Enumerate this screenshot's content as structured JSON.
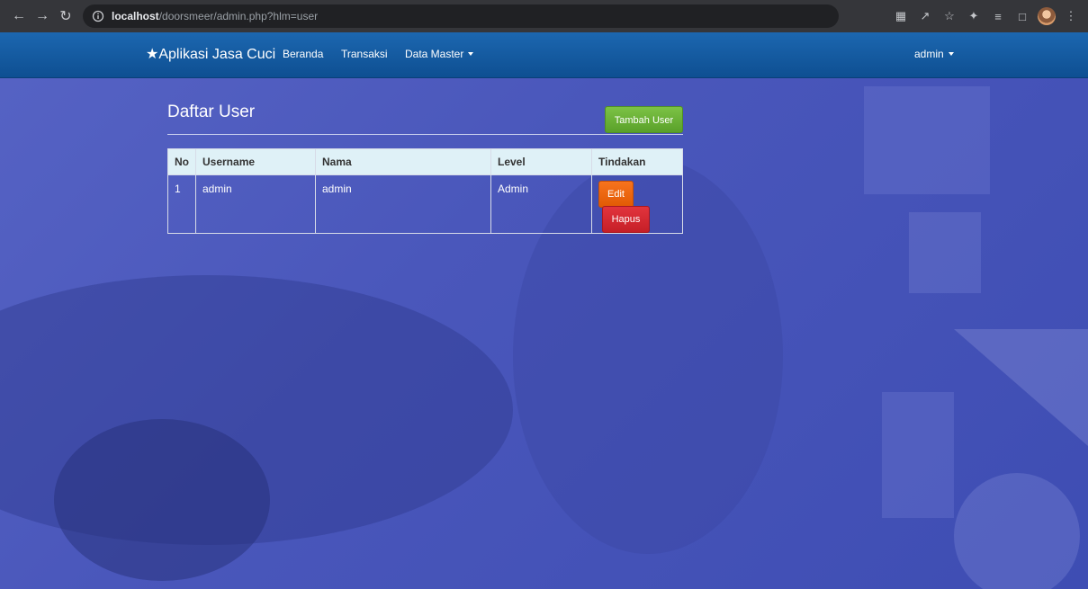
{
  "browser": {
    "url_host": "localhost",
    "url_path": "/doorsmeer/admin.php?hlm=user",
    "back_icon": "arrow-left-icon",
    "forward_icon": "arrow-right-icon",
    "reload_icon": "reload-icon"
  },
  "navbar": {
    "brand": "★Aplikasi Jasa Cuci",
    "links": [
      "Beranda",
      "Transaksi",
      "Data Master"
    ],
    "user": "admin",
    "color": "#1565ad"
  },
  "main": {
    "title": "Daftar User",
    "add_button": "Tambah User",
    "table": {
      "headers": [
        "No",
        "Username",
        "Nama",
        "Level",
        "Tindakan"
      ],
      "rows": [
        {
          "no": "1",
          "username": "admin",
          "nama": "admin",
          "level": "Admin",
          "edit": "Edit",
          "delete": "Hapus"
        }
      ]
    }
  },
  "colors": {
    "background": "#4a57bb",
    "button_add": "#6ab23a",
    "button_edit": "#f06b12",
    "button_delete": "#d22a32"
  }
}
